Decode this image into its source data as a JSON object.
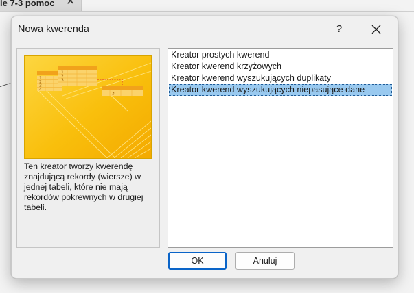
{
  "background_tab": {
    "label": "ie 7-3 pomoc",
    "close_glyph": "✕"
  },
  "dialog": {
    "title": "Nowa kwerenda",
    "help_label": "?",
    "close_icon": "close-icon",
    "description": "Ten kreator tworzy kwerendę znajdującą rekordy (wiersze) w jednej tabeli, które nie mają rekordów pokrewnych w drugiej tabeli.",
    "illustration": {
      "numbers_left": [
        "1",
        "2",
        "3",
        "4"
      ],
      "numbers_mid": [
        "1",
        "2",
        "3"
      ],
      "number_right": "3"
    },
    "list_items": [
      "Kreator prostych kwerend",
      "Kreator kwerend krzyżowych",
      "Kreator kwerend wyszukujących duplikaty",
      "Kreator kwerend wyszukujących niepasujące dane"
    ],
    "selected_index": 3,
    "ok_label": "OK",
    "cancel_label": "Anuluj"
  },
  "colors": {
    "selection": "#99c9ef",
    "ok_border": "#0a64c8",
    "illustration_gold": "#f7b500"
  }
}
